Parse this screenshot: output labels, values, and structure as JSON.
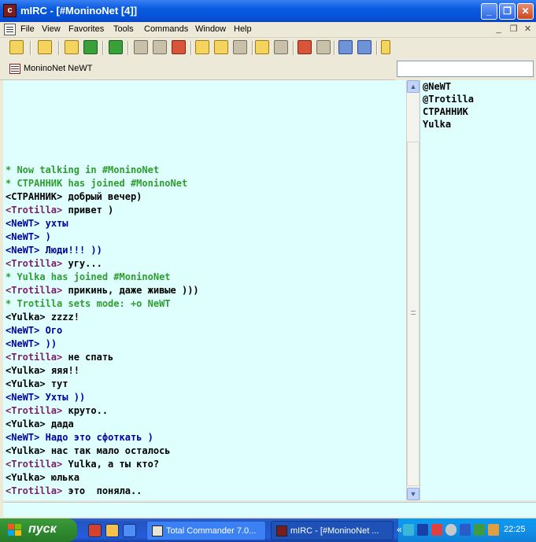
{
  "window": {
    "app_icon_text": "c",
    "title": "mIRC - [#MoninoNet [4]]",
    "controls": [
      "_",
      "❐",
      "✕"
    ]
  },
  "menu": {
    "items": [
      "File",
      "View",
      "Favorites",
      "Tools",
      "Commands",
      "Window",
      "Help"
    ],
    "mdi_controls": [
      "_",
      "❐",
      "✕"
    ]
  },
  "switchbar": {
    "channel_label": "MoninoNet NeWT"
  },
  "messages": [
    {
      "type": "event",
      "text": "* Now talking in #MoninoNet"
    },
    {
      "type": "event",
      "text": "* СТРАННИК has joined #MoninoNet"
    },
    {
      "type": "msg",
      "nick": "СТРАННИК",
      "style": "default",
      "text": "добрый вечер)"
    },
    {
      "type": "msg",
      "nick": "Trotilla",
      "style": "Trotilla",
      "text": "привет )"
    },
    {
      "type": "msg",
      "nick": "NeWT",
      "style": "NeWT",
      "text": "ухты"
    },
    {
      "type": "msg",
      "nick": "NeWT",
      "style": "NeWT",
      "text": ")"
    },
    {
      "type": "msg",
      "nick": "NeWT",
      "style": "NeWT",
      "text": "Люди!!! ))"
    },
    {
      "type": "msg",
      "nick": "Trotilla",
      "style": "Trotilla",
      "text": "угу..."
    },
    {
      "type": "event",
      "text": "* Yulka has joined #MoninoNet"
    },
    {
      "type": "msg",
      "nick": "Trotilla",
      "style": "Trotilla",
      "text": "прикинь, даже живые )))"
    },
    {
      "type": "event",
      "text": "* Trotilla sets mode: +o NeWT"
    },
    {
      "type": "msg",
      "nick": "Yulka",
      "style": "default",
      "text": "zzzz!"
    },
    {
      "type": "msg",
      "nick": "NeWT",
      "style": "NeWT",
      "text": "Ого"
    },
    {
      "type": "msg",
      "nick": "NeWT",
      "style": "NeWT",
      "text": "))"
    },
    {
      "type": "msg",
      "nick": "Trotilla",
      "style": "Trotilla",
      "text": "не спать"
    },
    {
      "type": "msg",
      "nick": "Yulka",
      "style": "default",
      "text": "яяя!!"
    },
    {
      "type": "msg",
      "nick": "Yulka",
      "style": "default",
      "text": "тут"
    },
    {
      "type": "msg",
      "nick": "NeWT",
      "style": "NeWT",
      "text": "Ухты ))"
    },
    {
      "type": "msg",
      "nick": "Trotilla",
      "style": "Trotilla",
      "text": "круто.."
    },
    {
      "type": "msg",
      "nick": "Yulka",
      "style": "default",
      "text": "дада"
    },
    {
      "type": "msg",
      "nick": "NeWT",
      "style": "NeWT",
      "text": "Надо это сфоткать )"
    },
    {
      "type": "msg",
      "nick": "Yulka",
      "style": "default",
      "text": "нас так мало осталось"
    },
    {
      "type": "msg",
      "nick": "Trotilla",
      "style": "Trotilla",
      "text": "Yulka, а ты кто?"
    },
    {
      "type": "msg",
      "nick": "Yulka",
      "style": "default",
      "text": "юлька"
    },
    {
      "type": "msg",
      "nick": "Trotilla",
      "style": "Trotilla",
      "text": "это  поняла.."
    }
  ],
  "nicklist": [
    "@NeWT",
    "@Trotilla",
    "СТРАННИК",
    "Yulka"
  ],
  "colors": {
    "chat_background": "#DFFEFE",
    "event_text": "#2E9E2E",
    "nick_trotilla": "#7B1F6A",
    "nick_newt": "#0000A0"
  },
  "scrollbar": {
    "up_arrow": "▲",
    "down_arrow": "▼"
  },
  "taskbar": {
    "start_label": "пуск",
    "tasks": [
      {
        "label": "Total Commander 7.0...",
        "active": false
      },
      {
        "label": "mIRC - [#MoninoNet ...",
        "active": true
      }
    ],
    "more_arrow": "«",
    "clock": "22:25"
  }
}
